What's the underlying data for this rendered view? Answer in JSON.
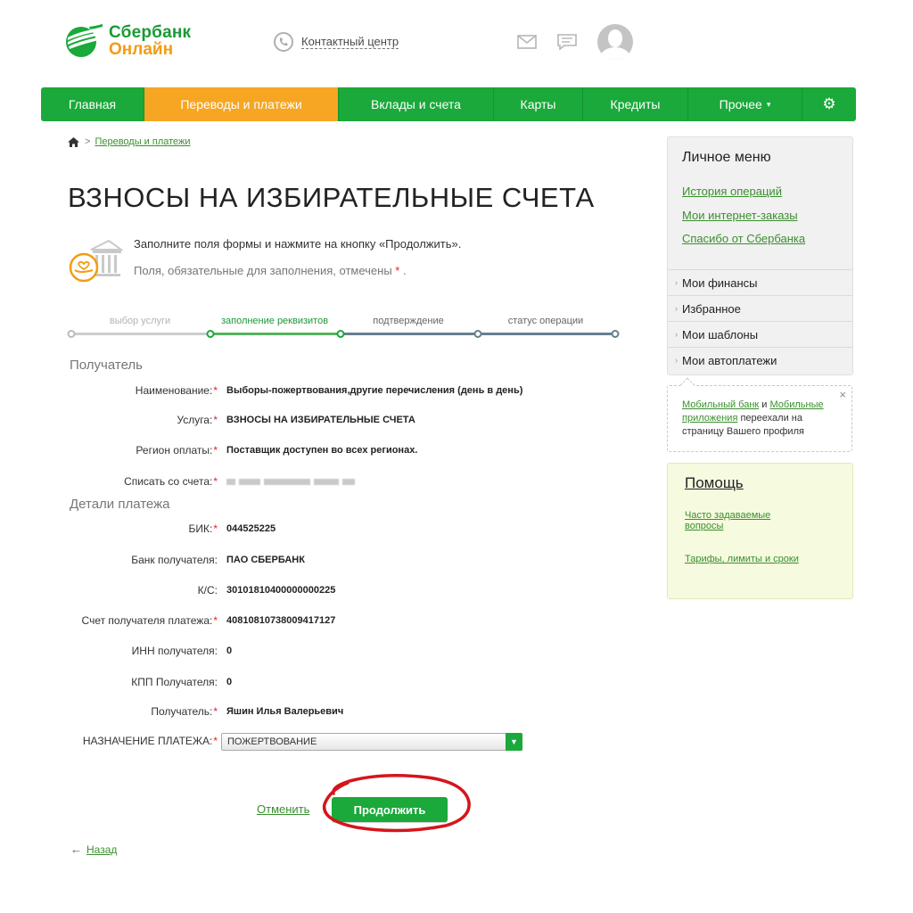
{
  "header": {
    "logo_line1": "Сбербанк",
    "logo_line2": "Онлайн",
    "contact_label": "Контактный центр"
  },
  "nav": {
    "items": [
      "Главная",
      "Переводы и платежи",
      "Вклады и счета",
      "Карты",
      "Кредиты",
      "Прочее"
    ],
    "active_index": 1,
    "more_caret": "▾"
  },
  "breadcrumb": {
    "separator": ">",
    "link": "Переводы и платежи"
  },
  "page_title": "ВЗНОСЫ НА ИЗБИРАТЕЛЬНЫЕ СЧЕТА",
  "info": {
    "line1": "Заполните поля формы и нажмите на кнопку «Продолжить».",
    "line2_prefix": "Поля, обязательные для заполнения, отмечены",
    "required_mark": "*",
    "line2_suffix": "."
  },
  "steps": [
    {
      "label": "выбор услуги",
      "state": "done"
    },
    {
      "label": "заполнение реквизитов",
      "state": "current"
    },
    {
      "label": "подтверждение",
      "state": "todo"
    },
    {
      "label": "статус операции",
      "state": "todo"
    }
  ],
  "sections": {
    "recipient": "Получатель",
    "details": "Детали платежа"
  },
  "fields": {
    "name": {
      "label": "Наименование:",
      "required": "*",
      "value": "Выборы-пожертвования,другие перечисления (день в день)"
    },
    "service": {
      "label": "Услуга:",
      "required": "*",
      "value": "ВЗНОСЫ НА ИЗБИРАТЕЛЬНЫЕ СЧЕТА"
    },
    "region": {
      "label": "Регион оплаты:",
      "required": "*",
      "value": "Поставщик доступен во всех регионах."
    },
    "account": {
      "label": "Списать со счета:",
      "required": "*"
    },
    "bik": {
      "label": "БИК:",
      "required": "*",
      "value": "044525225"
    },
    "bank": {
      "label": "Банк получателя:",
      "value": "ПАО СБЕРБАНК"
    },
    "ks": {
      "label": "К/С:",
      "value": "30101810400000000225"
    },
    "recipient_account": {
      "label": "Счет получателя платежа:",
      "required": "*",
      "value": "40810810738009417127"
    },
    "inn": {
      "label": "ИНН получателя:",
      "value": "0"
    },
    "kpp": {
      "label": "КПП Получателя:",
      "value": "0"
    },
    "recipient": {
      "label": "Получатель:",
      "required": "*",
      "value": "Яшин Илья Валерьевич"
    },
    "purpose": {
      "label": "НАЗНАЧЕНИЕ ПЛАТЕЖА:",
      "required": "*",
      "value": "ПОЖЕРТВОВАНИЕ"
    }
  },
  "actions": {
    "cancel": "Отменить",
    "continue": "Продолжить",
    "back": "Назад",
    "back_arrow": "←"
  },
  "personal_menu": {
    "title": "Личное меню",
    "links": [
      "История операций",
      "Мои интернет-заказы",
      "Спасибо от Сбербанка"
    ],
    "items": [
      "Мои финансы",
      "Избранное",
      "Мои шаблоны",
      "Мои автоплатежи"
    ]
  },
  "notice": {
    "link1": "Мобильный банк",
    "and": " и ",
    "link2": "Мобильные приложения",
    "text": " переехали на страницу Вашего профиля",
    "close": "×"
  },
  "help": {
    "title": "Помощь",
    "links": [
      "Часто задаваемые вопросы",
      "Тарифы, лимиты и сроки"
    ]
  },
  "colors": {
    "brand_green": "#1aa93a",
    "active_orange": "#f6a623",
    "link_green": "#3a8f2e",
    "required_red": "#e0212a",
    "annotation_red": "#d4151c",
    "help_bg": "#f6fadf"
  },
  "icons": {
    "logo": "sberbank-logo",
    "phone": "phone-icon",
    "mail": "mail-icon",
    "chat": "chat-icon",
    "avatar": "user-avatar",
    "settings": "gear-icon",
    "home": "home-icon",
    "info": "bank-building-icon"
  }
}
